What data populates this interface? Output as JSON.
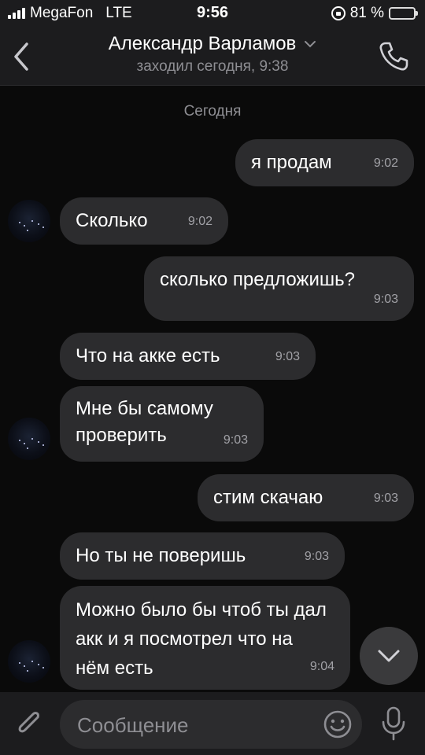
{
  "status_bar": {
    "carrier": "MegaFon",
    "network": "LTE",
    "time": "9:56",
    "battery": "81 %",
    "battery_level": 0.81,
    "battery_color": "#f4c21a"
  },
  "header": {
    "title": "Александр Варламов",
    "subtitle": "заходил сегодня, 9:38"
  },
  "chat": {
    "date_separator": "Сегодня",
    "messages": [
      {
        "side": "out",
        "text": "я продам",
        "time": "9:02"
      },
      {
        "side": "in",
        "text": "Сколько",
        "time": "9:02"
      },
      {
        "side": "out",
        "text": "сколько предложишь?",
        "time": "9:03"
      },
      {
        "side": "in",
        "text": "Что на акке есть",
        "time": "9:03"
      },
      {
        "side": "in",
        "text": "Мне бы самому проверить",
        "time": "9:03"
      },
      {
        "side": "out",
        "text": "стим скачаю",
        "time": "9:03"
      },
      {
        "side": "in",
        "text": "Но ты не поверишь",
        "time": "9:03"
      },
      {
        "side": "in",
        "text": "Можно было бы чтоб ты дал акк и я посмотрел что на нём есть",
        "time": "9:04"
      }
    ]
  },
  "input": {
    "placeholder": "Сообщение"
  },
  "icons": {
    "back": "chevron-left-icon",
    "call": "phone-icon",
    "title_dropdown": "chevron-down-icon",
    "attach": "paperclip-icon",
    "emoji": "smiley-icon",
    "mic": "microphone-icon",
    "scroll_down": "chevron-down-icon"
  }
}
